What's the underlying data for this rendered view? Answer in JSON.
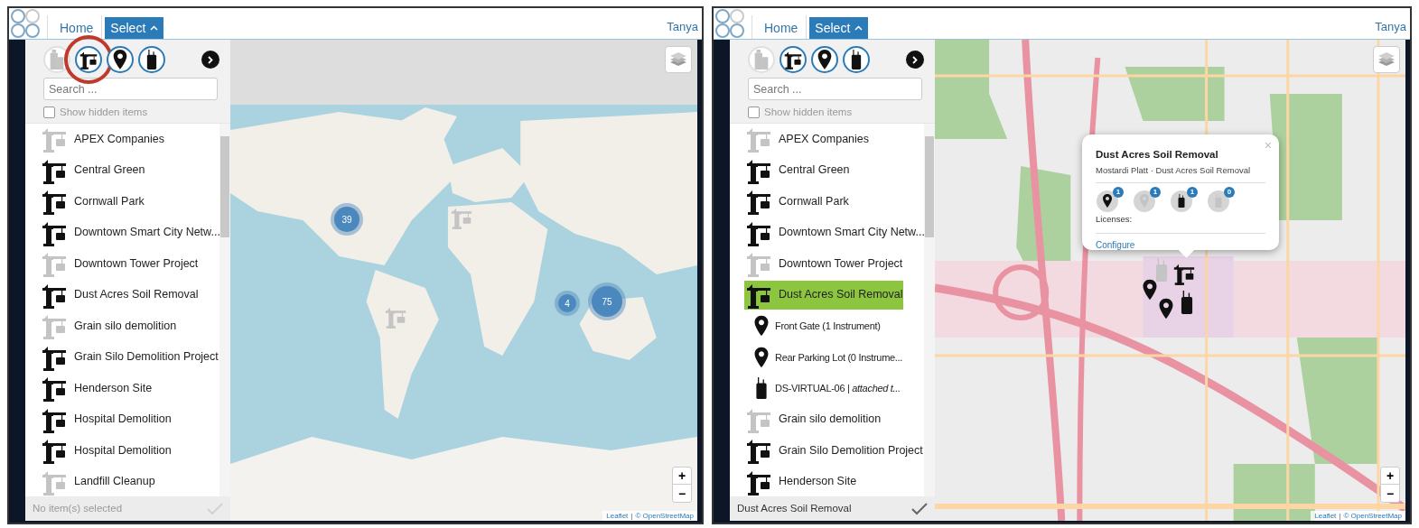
{
  "panels": [
    {
      "header": {
        "nav": [
          {
            "label": "Home",
            "kind": "link",
            "selected": false
          },
          {
            "label": "Select",
            "kind": "dropdown",
            "selected": true
          }
        ],
        "user": "Tanya"
      },
      "sidebar": {
        "filters": [
          {
            "kind": "building",
            "selected": false,
            "circled": false
          },
          {
            "kind": "crane",
            "selected": true,
            "circled": true
          },
          {
            "kind": "pin",
            "selected": true,
            "circled": false
          },
          {
            "kind": "device",
            "selected": true,
            "circled": false
          }
        ],
        "search": {
          "placeholder": "Search ..."
        },
        "show_hidden": {
          "label": "Show hidden items",
          "checked": false
        },
        "items": [
          {
            "label": "APEX Companies",
            "kind": "site",
            "dimmed": true,
            "selected": false
          },
          {
            "label": "Central Green",
            "kind": "site",
            "dimmed": false,
            "selected": false
          },
          {
            "label": "Cornwall Park",
            "kind": "site",
            "dimmed": false,
            "selected": false
          },
          {
            "label": "Downtown Smart City Netw...",
            "kind": "site",
            "dimmed": false,
            "selected": false
          },
          {
            "label": "Downtown Tower Project",
            "kind": "site",
            "dimmed": true,
            "selected": false
          },
          {
            "label": "Dust Acres Soil Removal",
            "kind": "site",
            "dimmed": false,
            "selected": false
          },
          {
            "label": "Grain silo demolition",
            "kind": "site",
            "dimmed": true,
            "selected": false
          },
          {
            "label": "Grain Silo Demolition Project",
            "kind": "site",
            "dimmed": false,
            "selected": false
          },
          {
            "label": "Henderson Site",
            "kind": "site",
            "dimmed": false,
            "selected": false
          },
          {
            "label": "Hospital Demolition",
            "kind": "site",
            "dimmed": false,
            "selected": false
          },
          {
            "label": "Hospital Demolition",
            "kind": "site",
            "dimmed": false,
            "selected": false
          },
          {
            "label": "Landfill Cleanup",
            "kind": "site",
            "dimmed": true,
            "selected": false
          }
        ],
        "footer": {
          "text": "No item(s) selected",
          "enabled": false
        }
      },
      "map": {
        "kind": "world",
        "clusters": [
          {
            "count": "39"
          },
          {
            "count": "4"
          },
          {
            "count": "75"
          }
        ],
        "markers": [
          {
            "kind": "crane",
            "dimmed": true
          },
          {
            "kind": "crane",
            "dimmed": true
          }
        ],
        "zoom": {
          "in": "+",
          "out": "−"
        },
        "attribution": {
          "links": [
            "Leaflet",
            "© OpenStreetMap"
          ],
          "separator": "|"
        }
      }
    },
    {
      "header": {
        "nav": [
          {
            "label": "Home",
            "kind": "link",
            "selected": false
          },
          {
            "label": "Select",
            "kind": "dropdown",
            "selected": true
          }
        ],
        "user": "Tanya"
      },
      "sidebar": {
        "filters": [
          {
            "kind": "building",
            "selected": false,
            "circled": false
          },
          {
            "kind": "crane",
            "selected": true,
            "circled": false
          },
          {
            "kind": "pin",
            "selected": true,
            "circled": false
          },
          {
            "kind": "device",
            "selected": true,
            "circled": false
          }
        ],
        "search": {
          "placeholder": "Search ..."
        },
        "show_hidden": {
          "label": "Show hidden items",
          "checked": false
        },
        "items": [
          {
            "label": "APEX Companies",
            "kind": "site",
            "dimmed": true,
            "selected": false
          },
          {
            "label": "Central Green",
            "kind": "site",
            "dimmed": false,
            "selected": false
          },
          {
            "label": "Cornwall Park",
            "kind": "site",
            "dimmed": false,
            "selected": false
          },
          {
            "label": "Downtown Smart City Netw...",
            "kind": "site",
            "dimmed": false,
            "selected": false
          },
          {
            "label": "Downtown Tower Project",
            "kind": "site",
            "dimmed": true,
            "selected": false
          },
          {
            "label": "Dust Acres Soil Removal",
            "kind": "site",
            "dimmed": false,
            "selected": true,
            "children": [
              {
                "label": "Front Gate (1 Instrument)",
                "kind": "location",
                "dimmed": false,
                "selected": false
              },
              {
                "label": "Rear Parking Lot (0 Instrume...",
                "kind": "location",
                "dimmed": false,
                "selected": false
              },
              {
                "label": "DS-VIRTUAL-06 | *attached t...*",
                "kind": "instrument",
                "dimmed": false,
                "selected": false
              }
            ]
          },
          {
            "label": "Grain silo demolition",
            "kind": "site",
            "dimmed": true,
            "selected": false
          },
          {
            "label": "Grain Silo Demolition Project",
            "kind": "site",
            "dimmed": false,
            "selected": false
          },
          {
            "label": "Henderson Site",
            "kind": "site",
            "dimmed": false,
            "selected": false
          }
        ],
        "footer": {
          "text": "Dust Acres Soil Removal",
          "enabled": true
        }
      },
      "map": {
        "kind": "street",
        "markers": [
          {
            "kind": "device",
            "dimmed": true
          },
          {
            "kind": "crane",
            "dimmed": false
          },
          {
            "kind": "pin",
            "dimmed": false
          },
          {
            "kind": "pin",
            "dimmed": false
          },
          {
            "kind": "device",
            "dimmed": false
          }
        ],
        "popup": {
          "title": "Dust Acres Soil Removal",
          "subtitle": "Mostardi Platt · Dust Acres Soil Removal",
          "close": "×",
          "counts": [
            {
              "kind": "pin",
              "dimmed": false,
              "count": "1"
            },
            {
              "kind": "pin",
              "dimmed": true,
              "count": "1"
            },
            {
              "kind": "device",
              "dimmed": false,
              "count": "1"
            },
            {
              "kind": "device",
              "dimmed": true,
              "count": "0"
            }
          ],
          "licenses": "Licenses:",
          "link": "Configure"
        },
        "zoom": {
          "in": "+",
          "out": "−"
        },
        "attribution": {
          "links": [
            "Leaflet",
            "© OpenStreetMap"
          ],
          "separator": "|"
        }
      }
    }
  ]
}
